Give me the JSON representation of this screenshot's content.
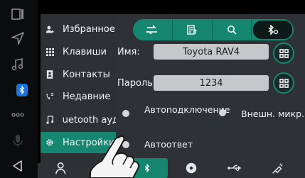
{
  "menu": {
    "items": [
      {
        "label": "Избранное",
        "icon": "person-star-icon"
      },
      {
        "label": "Клавиши",
        "icon": "keypad-icon"
      },
      {
        "label": "Контакты",
        "icon": "contacts-book-icon"
      },
      {
        "label": "Недавние",
        "icon": "recent-calls-icon"
      },
      {
        "label": "uetooth ауд",
        "icon": "music-note-icon"
      },
      {
        "label": "Настройки",
        "icon": "gear-icon"
      }
    ]
  },
  "settings": {
    "name_label": "Имя:",
    "name_value": "Toyota RAV4",
    "password_label": "Пароль:",
    "password_value": "1234",
    "auto_connect_label": "Автоподключение",
    "ext_mic_label": "Внешн. микр.",
    "auto_answer_label": "Автоответ"
  },
  "colors": {
    "accent": "#15866f",
    "bluetooth_blue": "#1c74d8"
  }
}
